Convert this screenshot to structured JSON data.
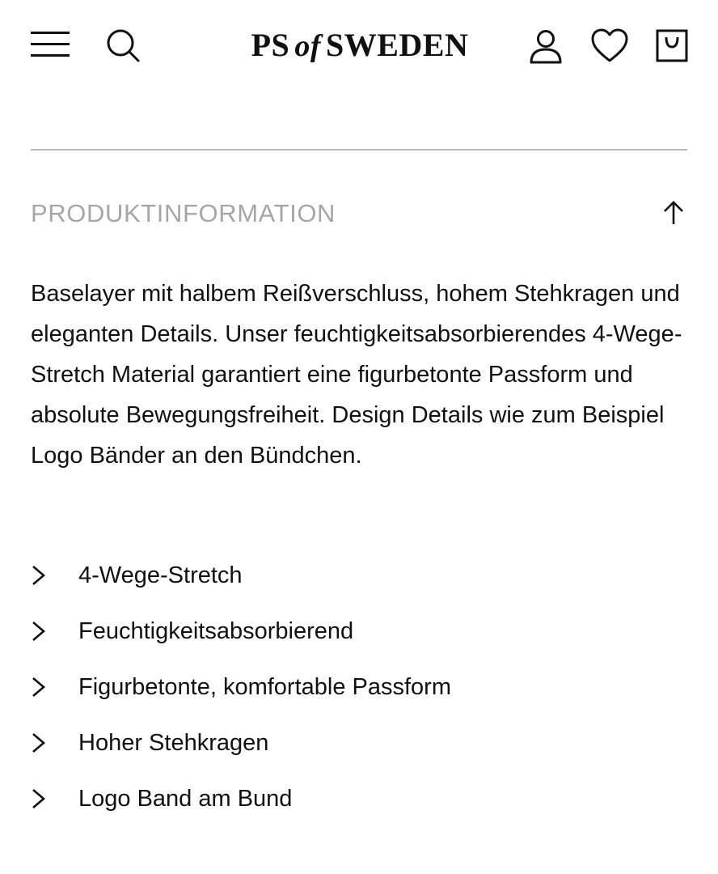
{
  "header": {
    "logo": {
      "part1": "PS",
      "part2": "of",
      "part3": "SWEDEN"
    },
    "icons": {
      "menu": "hamburger-menu-icon",
      "search": "search-icon",
      "account": "user-icon",
      "wishlist": "heart-icon",
      "cart": "shopping-bag-icon"
    }
  },
  "section": {
    "title": "PRODUKTINFORMATION",
    "toggle_icon": "arrow-up-icon",
    "description": "Baselayer mit halbem Reißverschluss, hohem Stehkragen und eleganten Details. Unser feuchtigkeitsabsorbierendes 4-Wege-Stretch Material garantiert eine figurbetonte Passform und absolute Bewegungsfreiheit. Design Details wie zum Beispiel Logo Bänder an den Bündchen.",
    "features": [
      "4-Wege-Stretch",
      "Feuchtigkeitsabsorbierend",
      "Figurbetonte, komfortable Passform",
      "Hoher Stehkragen",
      "Logo Band am Bund"
    ]
  },
  "colors": {
    "text": "#111111",
    "muted_title": "#a6a6a6",
    "divider": "#b8b8b8",
    "background": "#ffffff"
  }
}
